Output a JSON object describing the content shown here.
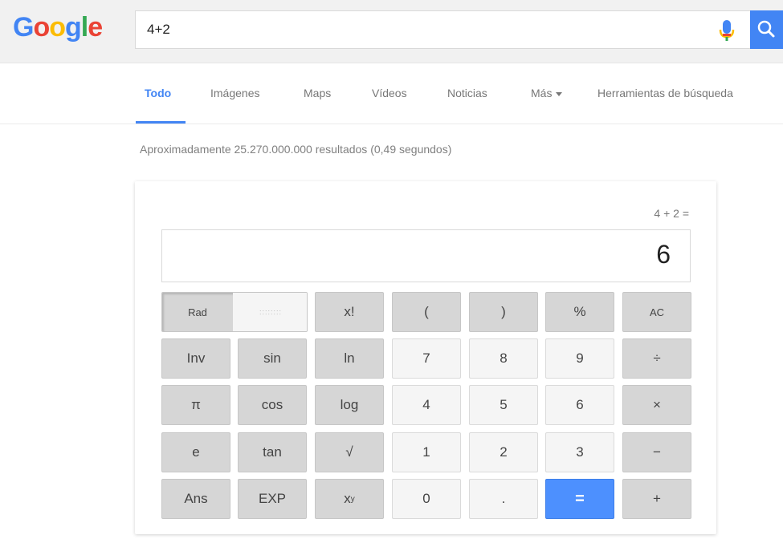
{
  "header": {
    "logo": {
      "G": "G",
      "o1": "o",
      "o2": "o",
      "g": "g",
      "l": "l",
      "e": "e"
    },
    "search": {
      "value": "4+2"
    }
  },
  "tabs": [
    {
      "label": "Todo"
    },
    {
      "label": "Imágenes"
    },
    {
      "label": "Maps"
    },
    {
      "label": "Vídeos"
    },
    {
      "label": "Noticias"
    },
    {
      "label": "Más"
    },
    {
      "label": "Herramientas de búsqueda"
    }
  ],
  "results": {
    "stats": "Aproximadamente 25.270.000.000 resultados (0,49 segundos)"
  },
  "calculator": {
    "expression": "4 + 2 =",
    "display": "6",
    "rad": "Rad",
    "deg": "::::::::",
    "keys": {
      "fact": "x!",
      "lparen": "(",
      "rparen": ")",
      "percent": "%",
      "ac": "AC",
      "inv": "Inv",
      "sin": "sin",
      "ln": "ln",
      "seven": "7",
      "eight": "8",
      "nine": "9",
      "divide": "÷",
      "pi": "π",
      "cos": "cos",
      "log": "log",
      "four": "4",
      "five": "5",
      "six": "6",
      "multiply": "×",
      "e": "e",
      "tan": "tan",
      "sqrt": "√",
      "one": "1",
      "two": "2",
      "three": "3",
      "minus": "−",
      "ans": "Ans",
      "exp": "EXP",
      "power_base": "x",
      "power_exp": "y",
      "zero": "0",
      "dot": ".",
      "equals": "=",
      "plus": "+"
    }
  },
  "colors": {
    "blue": "#4285f4",
    "red": "#ea4335",
    "yellow": "#fbbc05",
    "green": "#34a853",
    "equals": "#4d90fe"
  }
}
